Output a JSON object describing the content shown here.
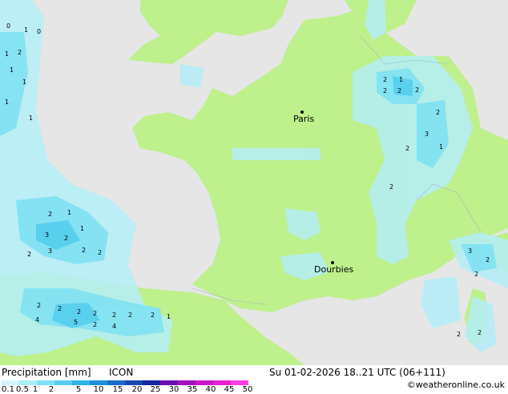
{
  "map": {
    "cities": [
      {
        "name": "Paris"
      },
      {
        "name": "Dourbies"
      }
    ]
  },
  "footer": {
    "title": "Precipitation [mm]",
    "model": "ICON",
    "datetime": "Su 01-02-2026 18..21 UTC (06+111)",
    "credit": "©weatheronline.co.uk"
  },
  "legend": {
    "ticks": [
      "0.1",
      "0.5",
      "1",
      "2",
      "5",
      "10",
      "15",
      "20",
      "25",
      "30",
      "35",
      "40",
      "45",
      "50"
    ],
    "colors": [
      "#d2f5fa",
      "#aaeef8",
      "#7fe1f3",
      "#55cdee",
      "#2db5e6",
      "#1c91d8",
      "#1a6cc8",
      "#1848b5",
      "#1526a0",
      "#6a0fb0",
      "#a010c0",
      "#c818c8",
      "#e820d0",
      "#f840e0"
    ]
  },
  "colors": {
    "land": "#bef08c",
    "sea": "#e6e6e6",
    "precip_light": "#b4eef8",
    "precip_mid": "#7fe1f3",
    "precip_heavy": "#55cdee"
  }
}
